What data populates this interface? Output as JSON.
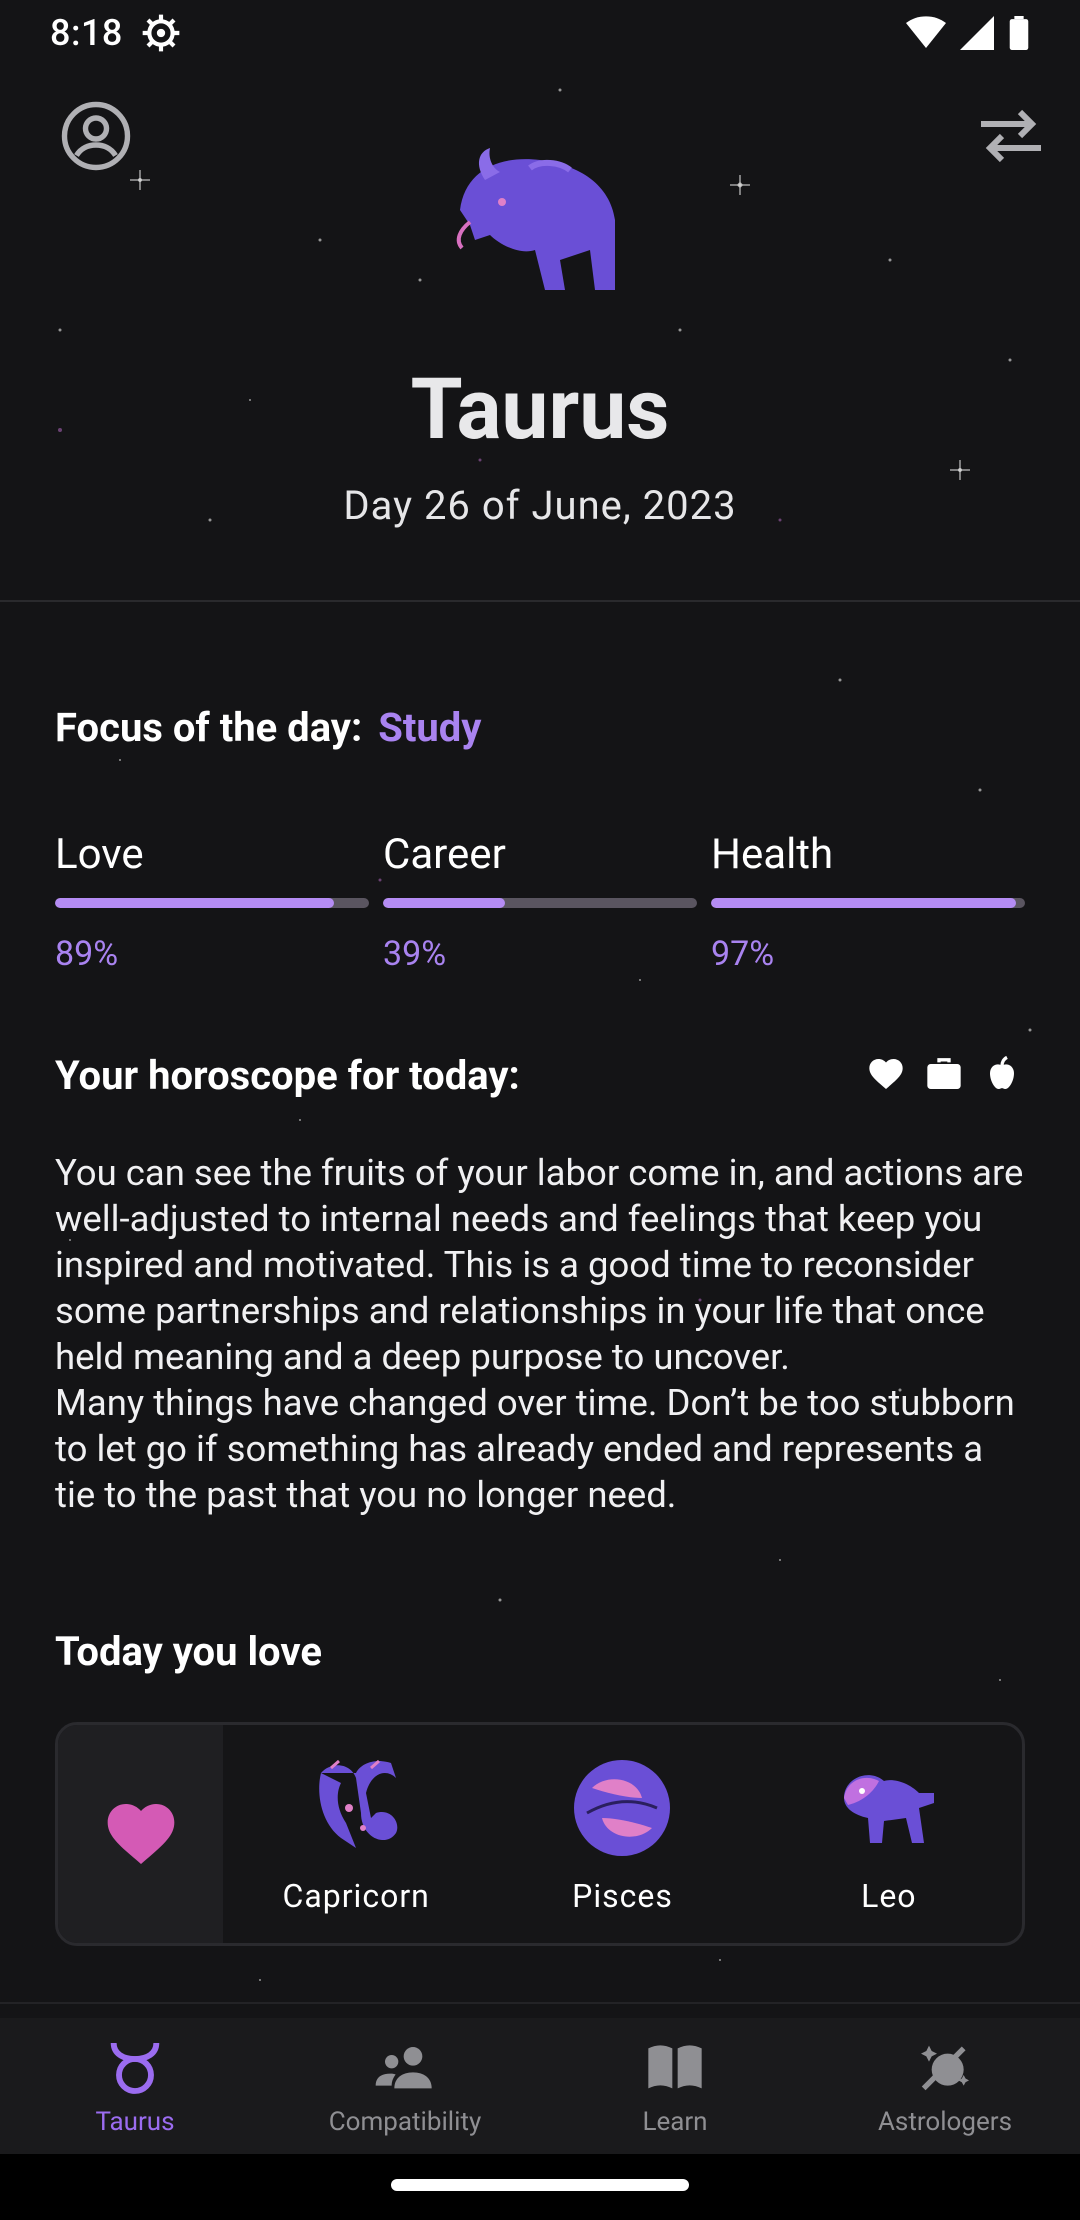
{
  "status_bar": {
    "time": "8:18"
  },
  "header": {
    "sign_name": "Taurus",
    "date_text": "Day 26 of June, 2023"
  },
  "focus": {
    "label": "Focus of the day:",
    "value": "Study"
  },
  "stats": [
    {
      "label": "Love",
      "percent_text": "89%",
      "value": 89
    },
    {
      "label": "Career",
      "percent_text": "39%",
      "value": 39
    },
    {
      "label": "Health",
      "percent_text": "97%",
      "value": 97
    }
  ],
  "horoscope": {
    "title": "Your horoscope for today:",
    "paragraph1": "You can see the fruits of your labor come in, and actions are well-adjusted to internal needs and feelings that keep you inspired and motivated. This is a good time to reconsider some partnerships and relationships in your life that once held meaning and a deep purpose to uncover.",
    "paragraph2": "Many things have changed over time. Don’t be too stubborn to let go if something has already ended and represents a tie to the past that you no longer need.",
    "icons": [
      "heart-icon",
      "briefcase-icon",
      "apple-icon"
    ]
  },
  "love": {
    "title": "Today you love",
    "signs": [
      {
        "name": "Capricorn",
        "icon": "capricorn-icon"
      },
      {
        "name": "Pisces",
        "icon": "pisces-icon"
      },
      {
        "name": "Leo",
        "icon": "leo-icon"
      }
    ]
  },
  "nav": {
    "items": [
      {
        "label": "Taurus",
        "icon": "taurus-icon",
        "active": true
      },
      {
        "label": "Compatibility",
        "icon": "people-icon",
        "active": false
      },
      {
        "label": "Learn",
        "icon": "book-icon",
        "active": false
      },
      {
        "label": "Astrologers",
        "icon": "astrologer-icon",
        "active": false
      }
    ]
  },
  "colors": {
    "accent": "#a983f0",
    "nav_active": "#9b6cf0",
    "background": "#141416",
    "heart": "#d45ab5",
    "sign_purple": "#6a4fd6"
  }
}
